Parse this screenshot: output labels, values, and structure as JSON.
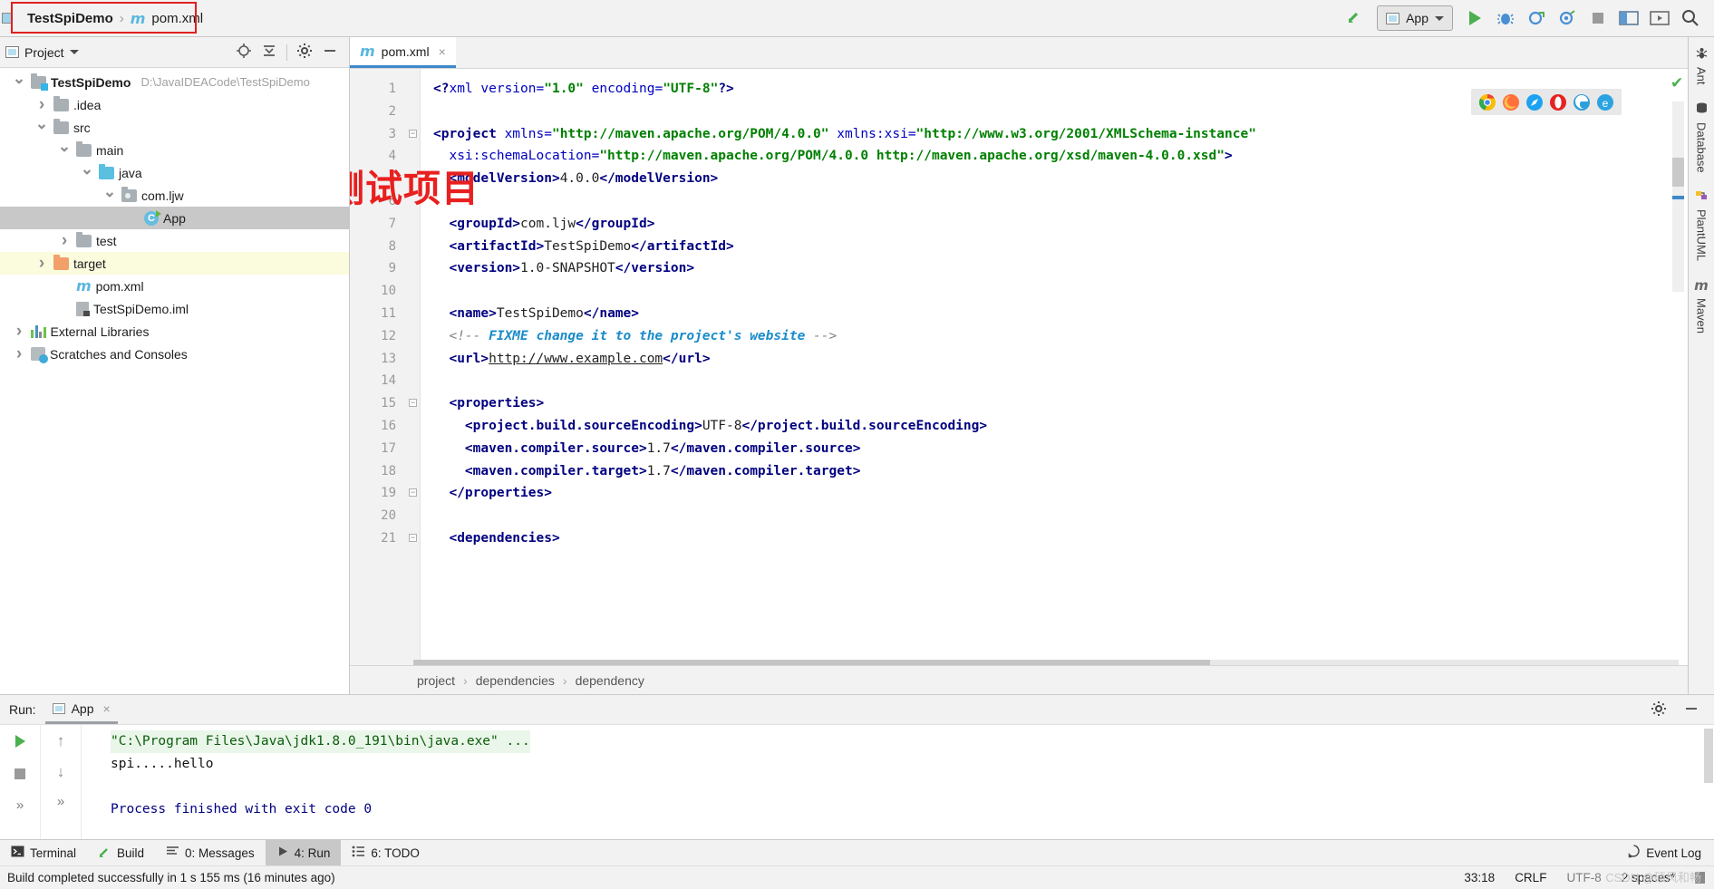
{
  "titlebar": {
    "breadcrumb": {
      "project": "TestSpiDemo",
      "separator": "›",
      "file": "pom.xml",
      "file_icon": "maven-m-icon"
    },
    "run_config": {
      "label": "App",
      "icon": "run-config-icon"
    },
    "icons": [
      "build-hammer-icon",
      "run-icon",
      "debug-icon",
      "run-with-coverage-icon",
      "profile-icon",
      "stop-icon",
      "layout-icon",
      "present-icon",
      "search-icon"
    ]
  },
  "project_panel": {
    "title": "Project",
    "header_icons": [
      "locate-icon",
      "collapse-all-icon",
      "gear-icon",
      "minimize-icon"
    ],
    "tree": [
      {
        "label": "TestSpiDemo",
        "path": "D:\\JavaIDEACode\\TestSpiDemo",
        "arrow": "open",
        "icon": "module-folder-icon",
        "indent": 0,
        "bold": true,
        "state": "normal"
      },
      {
        "label": ".idea",
        "path": "",
        "arrow": "closed",
        "icon": "folder-icon",
        "indent": 1,
        "bold": false,
        "state": "normal"
      },
      {
        "label": "src",
        "path": "",
        "arrow": "open",
        "icon": "folder-icon",
        "indent": 1,
        "bold": false,
        "state": "normal"
      },
      {
        "label": "main",
        "path": "",
        "arrow": "open",
        "icon": "folder-icon",
        "indent": 2,
        "bold": false,
        "state": "normal"
      },
      {
        "label": "java",
        "path": "",
        "arrow": "open",
        "icon": "source-folder-icon",
        "indent": 3,
        "bold": false,
        "state": "normal"
      },
      {
        "label": "com.ljw",
        "path": "",
        "arrow": "open",
        "icon": "package-icon",
        "indent": 4,
        "bold": false,
        "state": "normal"
      },
      {
        "label": "App",
        "path": "",
        "arrow": "none",
        "icon": "java-class-icon",
        "indent": 5,
        "bold": false,
        "state": "selected"
      },
      {
        "label": "test",
        "path": "",
        "arrow": "closed",
        "icon": "folder-icon",
        "indent": 2,
        "bold": false,
        "state": "normal"
      },
      {
        "label": "target",
        "path": "",
        "arrow": "closed",
        "icon": "excluded-folder-icon",
        "indent": 1,
        "bold": false,
        "state": "highlighted"
      },
      {
        "label": "pom.xml",
        "path": "",
        "arrow": "none",
        "icon": "maven-m-icon",
        "indent": 2,
        "bold": false,
        "state": "normal"
      },
      {
        "label": "TestSpiDemo.iml",
        "path": "",
        "arrow": "none",
        "icon": "iml-file-icon",
        "indent": 2,
        "bold": false,
        "state": "normal"
      },
      {
        "label": "External Libraries",
        "path": "",
        "arrow": "closed",
        "icon": "libraries-icon",
        "indent": 0,
        "bold": false,
        "state": "normal"
      },
      {
        "label": "Scratches and Consoles",
        "path": "",
        "arrow": "closed",
        "icon": "scratches-icon",
        "indent": 0,
        "bold": false,
        "state": "normal"
      }
    ]
  },
  "editor": {
    "tab": {
      "label": "pom.xml",
      "icon": "maven-m-icon",
      "close": "×"
    },
    "overlay_annotation": "测试项目",
    "browser_icons": [
      "chrome-icon",
      "firefox-icon",
      "safari-icon",
      "opera-icon",
      "edge-icon",
      "ie-icon"
    ],
    "lines": [
      {
        "n": "1",
        "fold": "",
        "parts": [
          {
            "c": "t",
            "s": "<?"
          },
          {
            "c": "an",
            "s": "xml "
          },
          {
            "c": "an",
            "s": "version="
          },
          {
            "c": "av",
            "s": "\"1.0\""
          },
          {
            "c": "an",
            "s": " encoding="
          },
          {
            "c": "av",
            "s": "\"UTF-8\""
          },
          {
            "c": "t",
            "s": "?>"
          }
        ]
      },
      {
        "n": "2",
        "fold": "",
        "parts": []
      },
      {
        "n": "3",
        "fold": "minus",
        "parts": [
          {
            "c": "t",
            "s": "<project "
          },
          {
            "c": "an",
            "s": "xmlns="
          },
          {
            "c": "av",
            "s": "\"http://maven.apache.org/POM/4.0.0\""
          },
          {
            "c": "an",
            "s": " xmlns:xsi="
          },
          {
            "c": "av",
            "s": "\"http://www.w3.org/2001/XMLSchema-instance\""
          }
        ]
      },
      {
        "n": "4",
        "fold": "",
        "parts": [
          {
            "c": "an",
            "s": "  xsi:schemaLocation="
          },
          {
            "c": "av",
            "s": "\"http://maven.apache.org/POM/4.0.0 http://maven.apache.org/xsd/maven-4.0.0.xsd\""
          },
          {
            "c": "t",
            "s": ">"
          }
        ]
      },
      {
        "n": "5",
        "fold": "",
        "parts": [
          {
            "c": "t",
            "s": "  <modelVersion>"
          },
          {
            "c": "txt",
            "s": "4.0.0"
          },
          {
            "c": "t",
            "s": "</modelVersion>"
          }
        ]
      },
      {
        "n": "6",
        "fold": "",
        "parts": []
      },
      {
        "n": "7",
        "fold": "",
        "parts": [
          {
            "c": "t",
            "s": "  <groupId>"
          },
          {
            "c": "txt",
            "s": "com.ljw"
          },
          {
            "c": "t",
            "s": "</groupId>"
          }
        ]
      },
      {
        "n": "8",
        "fold": "",
        "parts": [
          {
            "c": "t",
            "s": "  <artifactId>"
          },
          {
            "c": "txt",
            "s": "TestSpiDemo"
          },
          {
            "c": "t",
            "s": "</artifactId>"
          }
        ]
      },
      {
        "n": "9",
        "fold": "",
        "parts": [
          {
            "c": "t",
            "s": "  <version>"
          },
          {
            "c": "txt",
            "s": "1.0-SNAPSHOT"
          },
          {
            "c": "t",
            "s": "</version>"
          }
        ]
      },
      {
        "n": "10",
        "fold": "",
        "parts": []
      },
      {
        "n": "11",
        "fold": "",
        "parts": [
          {
            "c": "t",
            "s": "  <name>"
          },
          {
            "c": "txt",
            "s": "TestSpiDemo"
          },
          {
            "c": "t",
            "s": "</name>"
          }
        ]
      },
      {
        "n": "12",
        "fold": "",
        "parts": [
          {
            "c": "cmt",
            "s": "  <!-- "
          },
          {
            "c": "cmtb",
            "s": "FIXME change it to the project's website"
          },
          {
            "c": "cmt",
            "s": " -->"
          }
        ]
      },
      {
        "n": "13",
        "fold": "",
        "parts": [
          {
            "c": "t",
            "s": "  <url>"
          },
          {
            "c": "url",
            "s": "http://www.example.com"
          },
          {
            "c": "t",
            "s": "</url>"
          }
        ]
      },
      {
        "n": "14",
        "fold": "",
        "parts": []
      },
      {
        "n": "15",
        "fold": "minus",
        "parts": [
          {
            "c": "t",
            "s": "  <properties>"
          }
        ]
      },
      {
        "n": "16",
        "fold": "",
        "parts": [
          {
            "c": "t",
            "s": "    <project.build.sourceEncoding>"
          },
          {
            "c": "txt",
            "s": "UTF-8"
          },
          {
            "c": "t",
            "s": "</project.build.sourceEncoding>"
          }
        ]
      },
      {
        "n": "17",
        "fold": "",
        "parts": [
          {
            "c": "t",
            "s": "    <maven.compiler.source>"
          },
          {
            "c": "txt",
            "s": "1.7"
          },
          {
            "c": "t",
            "s": "</maven.compiler.source>"
          }
        ]
      },
      {
        "n": "18",
        "fold": "",
        "parts": [
          {
            "c": "t",
            "s": "    <maven.compiler.target>"
          },
          {
            "c": "txt",
            "s": "1.7"
          },
          {
            "c": "t",
            "s": "</maven.compiler.target>"
          }
        ]
      },
      {
        "n": "19",
        "fold": "minus",
        "parts": [
          {
            "c": "t",
            "s": "  </properties>"
          }
        ]
      },
      {
        "n": "20",
        "fold": "",
        "parts": []
      },
      {
        "n": "21",
        "fold": "minus",
        "parts": [
          {
            "c": "t",
            "s": "  <dependencies>"
          }
        ]
      }
    ],
    "breadcrumbs": [
      "project",
      "dependencies",
      "dependency"
    ],
    "breadcrumb_separator": "›"
  },
  "right_strip": {
    "tools": [
      {
        "label": "Ant",
        "icon": "ant-icon"
      },
      {
        "label": "Database",
        "icon": "database-icon"
      },
      {
        "label": "PlantUML",
        "icon": "plantuml-icon"
      },
      {
        "label": "Maven",
        "icon": "maven-m-icon"
      }
    ]
  },
  "run_panel": {
    "label": "Run:",
    "tab": {
      "label": "App",
      "close": "×",
      "icon": "run-config-icon"
    },
    "header_icons": [
      "gear-icon",
      "minimize-icon"
    ],
    "side_icons": [
      "rerun-icon",
      "stop-icon",
      "expand-more-icon"
    ],
    "side2_icons": [
      "scroll-up-icon",
      "scroll-down-icon",
      "expand-more-icon"
    ],
    "console": [
      {
        "text": "\"C:\\Program Files\\Java\\jdk1.8.0_191\\bin\\java.exe\" ...",
        "style": "cmd"
      },
      {
        "text": "spi.....hello",
        "style": "out"
      },
      {
        "text": "",
        "style": "out"
      },
      {
        "text": "Process finished with exit code 0",
        "style": "exit"
      }
    ]
  },
  "bottom_toolstrip": {
    "items": [
      {
        "label": "Terminal",
        "icon": "terminal-icon",
        "active": false
      },
      {
        "label": "Build",
        "icon": "hammer-icon",
        "active": false
      },
      {
        "label": "0: Messages",
        "icon": "messages-icon",
        "active": false
      },
      {
        "label": "4: Run",
        "icon": "run-icon",
        "active": true
      },
      {
        "label": "6: TODO",
        "icon": "todo-icon",
        "active": false
      }
    ],
    "event_log": {
      "label": "Event Log",
      "icon": "event-log-icon"
    }
  },
  "statusbar": {
    "message": "Build completed successfully in 1 s 155 ms (16 minutes ago)",
    "caret": "33:18",
    "line_separator": "CRLF",
    "encoding": "UTF-8",
    "indent": "2 spaces*",
    "lock_icon": "lock-icon",
    "watermark": "CSDN @硕风和畅"
  },
  "colors": {
    "accent_blue": "#3d89cc",
    "tag_blue": "#000080",
    "string_green": "#008000",
    "run_green": "#4caf50",
    "annotation_red": "#e8201f",
    "selection_gray": "#c8c8c8",
    "highlight_yellow": "#fbfbdd"
  }
}
